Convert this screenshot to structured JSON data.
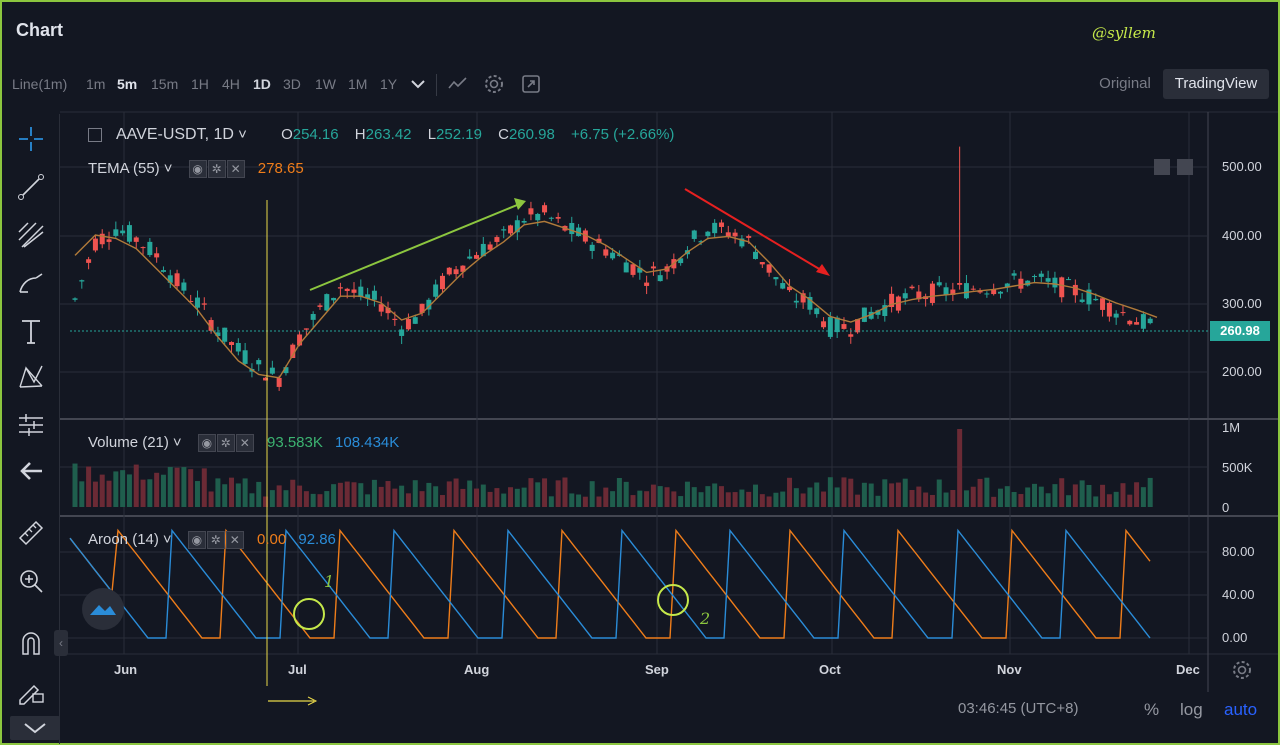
{
  "app": {
    "title": "Chart",
    "watermark": "@syllem"
  },
  "toolbar": {
    "timeframes": [
      "Line(1m)",
      "1m",
      "5m",
      "15m",
      "1H",
      "4H",
      "1D",
      "3D",
      "1W",
      "1M",
      "1Y"
    ],
    "active_timeframe": "5m",
    "original_label": "Original",
    "tradingview_label": "TradingView",
    "icons": [
      "chevron-down-icon",
      "indicators-icon",
      "gear-icon",
      "fullscreen-icon"
    ]
  },
  "left_tools": [
    "crosshair-icon",
    "trend-line-icon",
    "fib-icon",
    "brush-icon",
    "text-icon",
    "pattern-icon",
    "measure-icon",
    "back-arrow-icon",
    "ruler-icon",
    "zoom-icon",
    "magnet-icon",
    "lock-edit-icon"
  ],
  "legend": {
    "symbol": "AAVE-USDT, 1D",
    "open_label": "O",
    "open": "254.16",
    "high_label": "H",
    "high": "263.42",
    "low_label": "L",
    "low": "252.19",
    "close_label": "C",
    "close": "260.98",
    "change": "+6.75 (+2.66%)"
  },
  "indicators": {
    "tema": {
      "name": "TEMA (55)",
      "value": "278.65"
    },
    "volume": {
      "name": "Volume (21)",
      "value1": "93.583K",
      "value2": "108.434K"
    },
    "aroon": {
      "name": "Aroon (14)",
      "up_value": "0.00",
      "down_value": "92.86"
    }
  },
  "price_axis": {
    "labels": [
      "500.00",
      "400.00",
      "300.00",
      "200.00"
    ],
    "current": "260.98"
  },
  "volume_axis": {
    "labels": [
      "1M",
      "500K",
      "0"
    ]
  },
  "aroon_axis": {
    "labels": [
      "80.00",
      "40.00",
      "0.00"
    ]
  },
  "time_axis": {
    "labels": [
      "Jun",
      "Jul",
      "Aug",
      "Sep",
      "Oct",
      "Nov",
      "Dec"
    ]
  },
  "annotations": {
    "circle1": "1",
    "circle2": "2"
  },
  "footer": {
    "time": "03:46:45 (UTC+8)",
    "percent": "%",
    "log": "log",
    "auto": "auto"
  },
  "colors": {
    "up": "#26a69a",
    "down": "#ef5350",
    "tema": "#b07a3a",
    "aroon_up": "#ef7d1a",
    "aroon_down": "#2a8cd8",
    "accent_green": "#8cc63f"
  },
  "chart_data": {
    "type": "candlestick",
    "symbol": "AAVE-USDT",
    "interval": "1D",
    "y_range": [
      150,
      540
    ],
    "closes_approx": [
      305,
      390,
      410,
      395,
      370,
      330,
      300,
      260,
      230,
      205,
      190,
      250,
      290,
      325,
      310,
      300,
      265,
      285,
      330,
      360,
      380,
      395,
      425,
      430,
      410,
      395,
      380,
      360,
      340,
      350,
      385,
      410,
      405,
      390,
      350,
      310,
      300,
      265,
      265,
      285,
      300,
      310,
      315,
      318,
      322,
      325,
      330,
      335,
      326,
      318,
      305,
      290,
      275,
      261
    ],
    "tema_approx": [
      370,
      400,
      395,
      380,
      350,
      320,
      290,
      250,
      215,
      195,
      190,
      240,
      275,
      310,
      310,
      300,
      275,
      285,
      315,
      345,
      370,
      390,
      415,
      420,
      410,
      400,
      385,
      365,
      345,
      350,
      375,
      395,
      398,
      390,
      360,
      325,
      305,
      280,
      272,
      283,
      298,
      305,
      310,
      313,
      317,
      320,
      325,
      330,
      328,
      322,
      312,
      300,
      290,
      279
    ],
    "volume_current": "93.583K",
    "volume_ma": "108.434K",
    "aroon": {
      "up": 0.0,
      "down": 92.86
    }
  }
}
